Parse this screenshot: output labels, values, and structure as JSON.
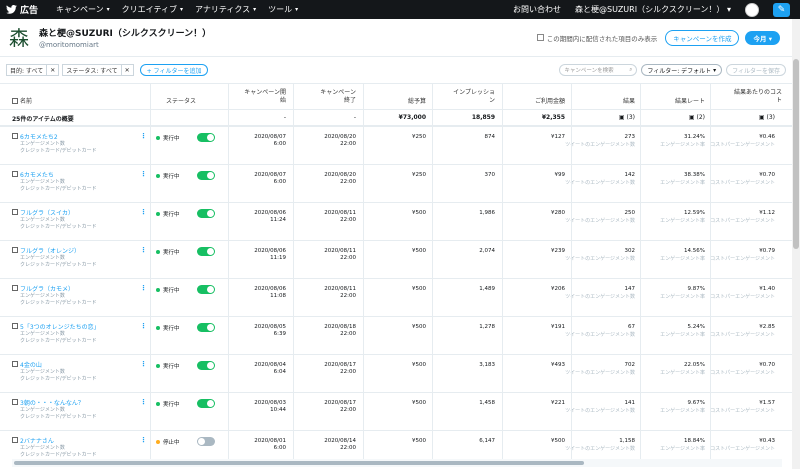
{
  "nav": {
    "brand": "広告",
    "menu": [
      {
        "label": "キャンペーン"
      },
      {
        "label": "クリエイティブ"
      },
      {
        "label": "アナリティクス"
      },
      {
        "label": "ツール"
      }
    ],
    "help": "お問い合わせ",
    "account": "森と梗@SUZURI（シルクスクリーン！）"
  },
  "account": {
    "avatar_text": "森",
    "name": "森と梗@SUZURI（シルクスクリーン！）",
    "handle": "@moritomomiart",
    "checkbox_label": "この期間内に配信された項目のみ表示",
    "create_button": "キャンペーンを作成",
    "date_button": "今月"
  },
  "filters": {
    "chip1": "目的: すべて",
    "chip2": "ステータス: すべて",
    "add_filter": "+ フィルターを追加",
    "search_placeholder": "キャンペーンを検索",
    "filter_select": "フィルター: デフォルト",
    "save_filter": "フィルターを保存"
  },
  "columns": {
    "name": "名前",
    "status": "ステータス",
    "start": "キャンペーン開始",
    "end": "キャンペーン終了",
    "budget": "総予算",
    "impressions": "インプレッション",
    "spend": "ご利用金額",
    "results": "結果",
    "result_rate": "結果レート",
    "cpr": "結果あたりのコスト"
  },
  "summary": {
    "label": "25件のアイテムの概要",
    "start": "-",
    "end": "-",
    "budget": "¥73,000",
    "impressions": "18,859",
    "spend": "¥2,355",
    "results": "(3)",
    "result_rate": "(2)",
    "cpr": "(3)"
  },
  "colors": {
    "accent": "#1da1f2",
    "active": "#17bf63",
    "paused": "#ffad1f"
  },
  "rows": [
    {
      "name": "6カモメたち2",
      "sub1": "エンゲージメント数",
      "sub2": "クレジットカード/デビットカード",
      "status": "実行中",
      "active": true,
      "start1": "2020/08/07",
      "start2": "6:00",
      "end1": "2020/08/20",
      "end2": "22:00",
      "budget": "¥250",
      "impressions": "874",
      "spend": "¥127",
      "results": "273",
      "results_sub": "ツイートのエンゲージメント数",
      "rate": "31.24%",
      "rate_sub": "エンゲージメント率",
      "cpr": "¥0.46",
      "cpr_sub": "コストパーエンゲージメント"
    },
    {
      "name": "6カモメたち",
      "sub1": "エンゲージメント数",
      "sub2": "クレジットカード/デビットカード",
      "status": "実行中",
      "active": true,
      "start1": "2020/08/07",
      "start2": "6:00",
      "end1": "2020/08/20",
      "end2": "22:00",
      "budget": "¥250",
      "impressions": "370",
      "spend": "¥99",
      "results": "142",
      "results_sub": "ツイートのエンゲージメント数",
      "rate": "38.38%",
      "rate_sub": "エンゲージメント率",
      "cpr": "¥0.70",
      "cpr_sub": "コストパーエンゲージメント"
    },
    {
      "name": "フルグラ（スイカ）",
      "sub1": "エンゲージメント数",
      "sub2": "クレジットカード/デビットカード",
      "status": "実行中",
      "active": true,
      "start1": "2020/08/06",
      "start2": "11:24",
      "end1": "2020/08/11",
      "end2": "22:00",
      "budget": "¥500",
      "impressions": "1,986",
      "spend": "¥280",
      "results": "250",
      "results_sub": "ツイートのエンゲージメント数",
      "rate": "12.59%",
      "rate_sub": "エンゲージメント率",
      "cpr": "¥1.12",
      "cpr_sub": "コストパーエンゲージメント"
    },
    {
      "name": "フルグラ（オレンジ）",
      "sub1": "エンゲージメント数",
      "sub2": "クレジットカード/デビットカード",
      "status": "実行中",
      "active": true,
      "start1": "2020/08/06",
      "start2": "11:19",
      "end1": "2020/08/11",
      "end2": "22:00",
      "budget": "¥500",
      "impressions": "2,074",
      "spend": "¥239",
      "results": "302",
      "results_sub": "ツイートのエンゲージメント数",
      "rate": "14.56%",
      "rate_sub": "エンゲージメント率",
      "cpr": "¥0.79",
      "cpr_sub": "コストパーエンゲージメント"
    },
    {
      "name": "フルグラ（カモメ）",
      "sub1": "エンゲージメント数",
      "sub2": "クレジットカード/デビットカード",
      "status": "実行中",
      "active": true,
      "start1": "2020/08/06",
      "start2": "11:08",
      "end1": "2020/08/11",
      "end2": "22:00",
      "budget": "¥500",
      "impressions": "1,489",
      "spend": "¥206",
      "results": "147",
      "results_sub": "ツイートのエンゲージメント数",
      "rate": "9.87%",
      "rate_sub": "エンゲージメント率",
      "cpr": "¥1.40",
      "cpr_sub": "コストパーエンゲージメント"
    },
    {
      "name": "5「3つのオレンジたちの恋」",
      "sub1": "エンゲージメント数",
      "sub2": "クレジットカード/デビットカード",
      "status": "実行中",
      "active": true,
      "start1": "2020/08/05",
      "start2": "6:39",
      "end1": "2020/08/18",
      "end2": "22:00",
      "budget": "¥500",
      "impressions": "1,278",
      "spend": "¥191",
      "results": "67",
      "results_sub": "ツイートのエンゲージメント数",
      "rate": "5.24%",
      "rate_sub": "エンゲージメント率",
      "cpr": "¥2.85",
      "cpr_sub": "コストパーエンゲージメント"
    },
    {
      "name": "4金の山",
      "sub1": "エンゲージメント数",
      "sub2": "クレジットカード/デビットカード",
      "status": "実行中",
      "active": true,
      "start1": "2020/08/04",
      "start2": "6:04",
      "end1": "2020/08/17",
      "end2": "22:00",
      "budget": "¥500",
      "impressions": "3,183",
      "spend": "¥493",
      "results": "702",
      "results_sub": "ツイートのエンゲージメント数",
      "rate": "22.05%",
      "rate_sub": "エンゲージメント率",
      "cpr": "¥0.70",
      "cpr_sub": "コストパーエンゲージメント"
    },
    {
      "name": "3朝の・・・なんなん？",
      "sub1": "エンゲージメント数",
      "sub2": "クレジットカード/デビットカード",
      "status": "実行中",
      "active": true,
      "start1": "2020/08/03",
      "start2": "10:44",
      "end1": "2020/08/17",
      "end2": "22:00",
      "budget": "¥500",
      "impressions": "1,458",
      "spend": "¥221",
      "results": "141",
      "results_sub": "ツイートのエンゲージメント数",
      "rate": "9.67%",
      "rate_sub": "エンゲージメント率",
      "cpr": "¥1.57",
      "cpr_sub": "コストパーエンゲージメント"
    },
    {
      "name": "2バナナさん",
      "sub1": "エンゲージメント数",
      "sub2": "クレジットカード/デビットカード",
      "status": "停止中",
      "active": false,
      "start1": "2020/08/01",
      "start2": "6:00",
      "end1": "2020/08/14",
      "end2": "22:00",
      "budget": "¥500",
      "impressions": "6,147",
      "spend": "¥500",
      "results": "1,158",
      "results_sub": "ツイートのエンゲージメント数",
      "rate": "18.84%",
      "rate_sub": "エンゲージメント率",
      "cpr": "¥0.43",
      "cpr_sub": "コストパーエンゲージメント"
    }
  ]
}
